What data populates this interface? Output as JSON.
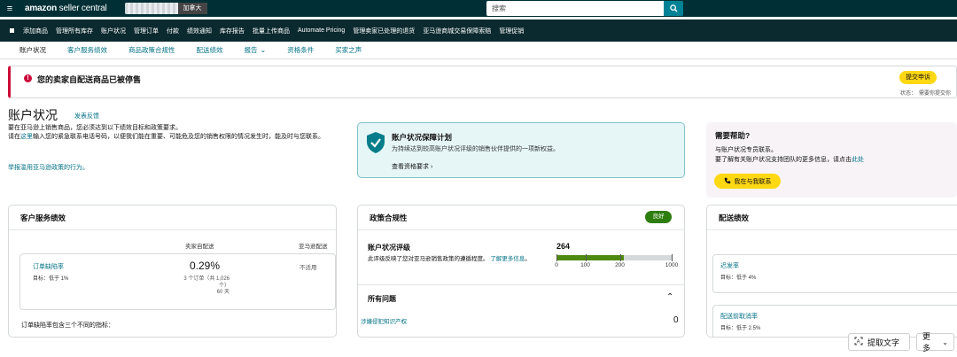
{
  "topbar": {
    "menu_icon": "hamburger-icon",
    "logo_main": "amazon",
    "logo_sub": "seller central",
    "marketplace": "加拿大",
    "search_placeholder": "搜索",
    "search_icon": "search-icon"
  },
  "nav": {
    "items": [
      "添加商品",
      "管理所有库存",
      "账户状况",
      "管理订单",
      "付款",
      "绩效通知",
      "库存报告",
      "批量上传商品",
      "Automate Pricing",
      "管理卖家已处理的退货",
      "亚马逊商城交易保障索赔",
      "管理促销"
    ]
  },
  "subtabs": {
    "items": [
      "账户状况",
      "客户服务绩效",
      "商品政策合规性",
      "配送绩效",
      "报告",
      "资格条件",
      "买家之声"
    ]
  },
  "alert": {
    "text": "您的卖家自配送商品已被停售",
    "appeal_button": "提交申诉",
    "status_label": "状态：",
    "status_value": "需要你提交你"
  },
  "page": {
    "title": "账户状况",
    "feedback_link": "发表反馈",
    "intro_line1": "要在亚马逊上销售商品，您必须达到以下绩效目标和政策要求。",
    "intro_line2_pre": "请在",
    "intro_line2_link": "这里",
    "intro_line2_post": "输入您的紧急联系电话号码，以便我们能在重要、可能危及您的销售权限的情况发生时，能及时与您联系。",
    "report_link": "举报滥用亚马逊政策的行为。"
  },
  "protection": {
    "title": "账户状况保障计划",
    "desc": "为持续达到较高账户状况评级的销售伙伴提供的一项新权益。",
    "link": "查看资格要求",
    "icon": "shield-check-icon",
    "color": "#067d8a"
  },
  "help": {
    "title": "需要帮助?",
    "line1": "与账户状况专员联系。",
    "line2_pre": "要了解有关账户状况支持团队的更多信息，请点击",
    "line2_link": "此处",
    "button": "我在与我联系",
    "phone_icon": "phone-icon"
  },
  "customer_service": {
    "title": "客户服务绩效",
    "col_seller": "卖家自配送",
    "col_amazon": "亚马逊配送",
    "metric_name": "订单缺陷率",
    "metric_target": "目标：低于 1%",
    "metric_value": "0.29%",
    "metric_detail_1": "3 个订单（共 1,026",
    "metric_detail_2": "个）",
    "metric_detail_3": "60 天",
    "metric_na": "不适用",
    "footer": "订单缺陷率包含三个不同的指标："
  },
  "policy": {
    "title": "政策合规性",
    "badge": "良好",
    "rating_title": "账户状况评级",
    "rating_desc_1": "此评级反映了您对亚马逊销售政策的遵循程度。",
    "rating_desc_link_1": "了解",
    "rating_desc_link_2": "更多信息",
    "rating_desc_end": "。",
    "score": 264,
    "scale": [
      "0",
      "100",
      "200",
      "1000"
    ],
    "issues_title": "所有问题",
    "issue_name": "涉嫌侵犯知识产权",
    "issue_count": "0",
    "colors": {
      "good": "#4f8a10",
      "track": "#d5d9d9"
    }
  },
  "shipping": {
    "title": "配送绩效",
    "metrics": [
      {
        "name": "迟发率",
        "target": "目标：低于 4%"
      },
      {
        "name": "配送前取消率",
        "target": "目标：低于 2.5%"
      }
    ]
  },
  "floating": {
    "extract": "提取文字",
    "more": "更多"
  }
}
